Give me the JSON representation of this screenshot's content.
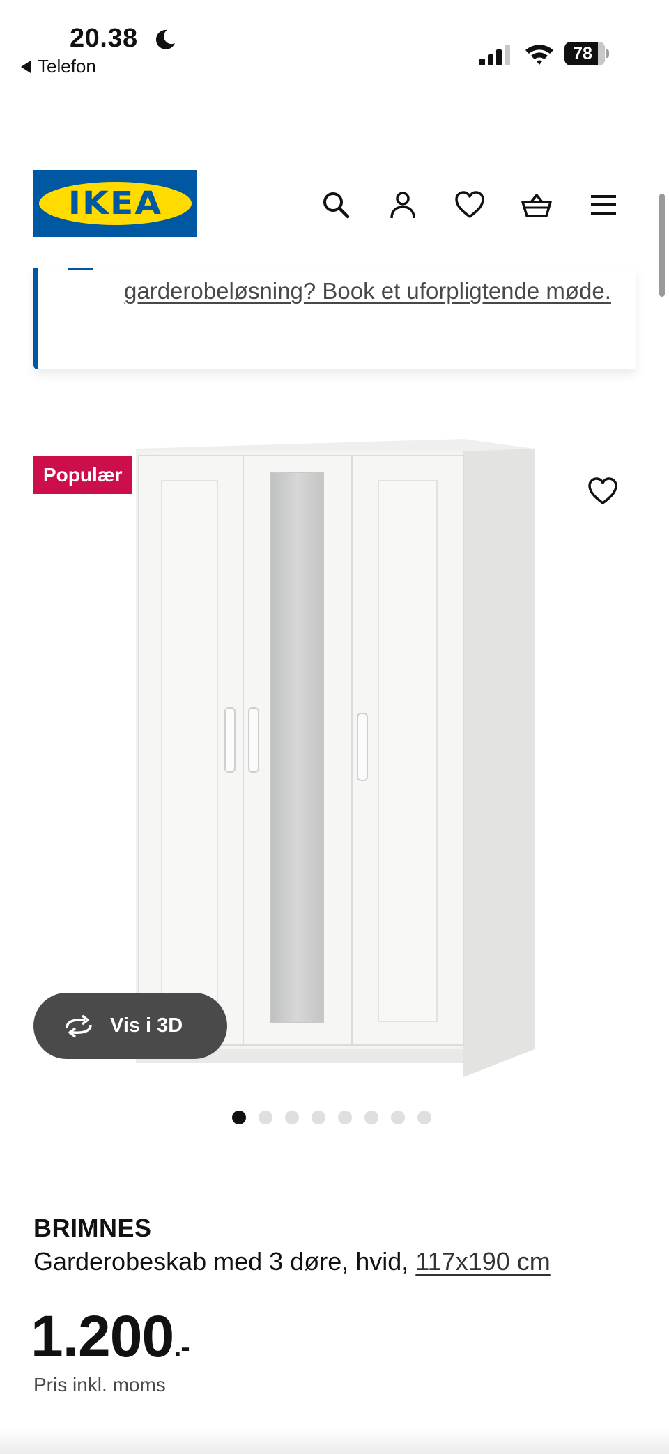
{
  "status_bar": {
    "time": "20.38",
    "back_label": "Telefon",
    "battery": "78"
  },
  "header": {
    "logo_text": "IKEA",
    "icons": [
      "search-icon",
      "user-icon",
      "heart-icon",
      "basket-icon",
      "menu-icon"
    ]
  },
  "banner": {
    "link_text": "garderobeløsning? Book et uforpligtende møde."
  },
  "product": {
    "badge": "Populær",
    "view_3d_label": "Vis i 3D",
    "image_count": 8,
    "active_image": 1,
    "name": "BRIMNES",
    "description": "Garderobeskab med 3 døre, hvid,",
    "size": "117x190 cm",
    "price": "1.200",
    "price_suffix": ".-",
    "price_note": "Pris inkl. moms"
  },
  "colors": {
    "ikea_blue": "#0058a3",
    "ikea_yellow": "#ffdb00",
    "badge_red": "#cc0e4b",
    "button_gray": "#4a4a4a"
  }
}
